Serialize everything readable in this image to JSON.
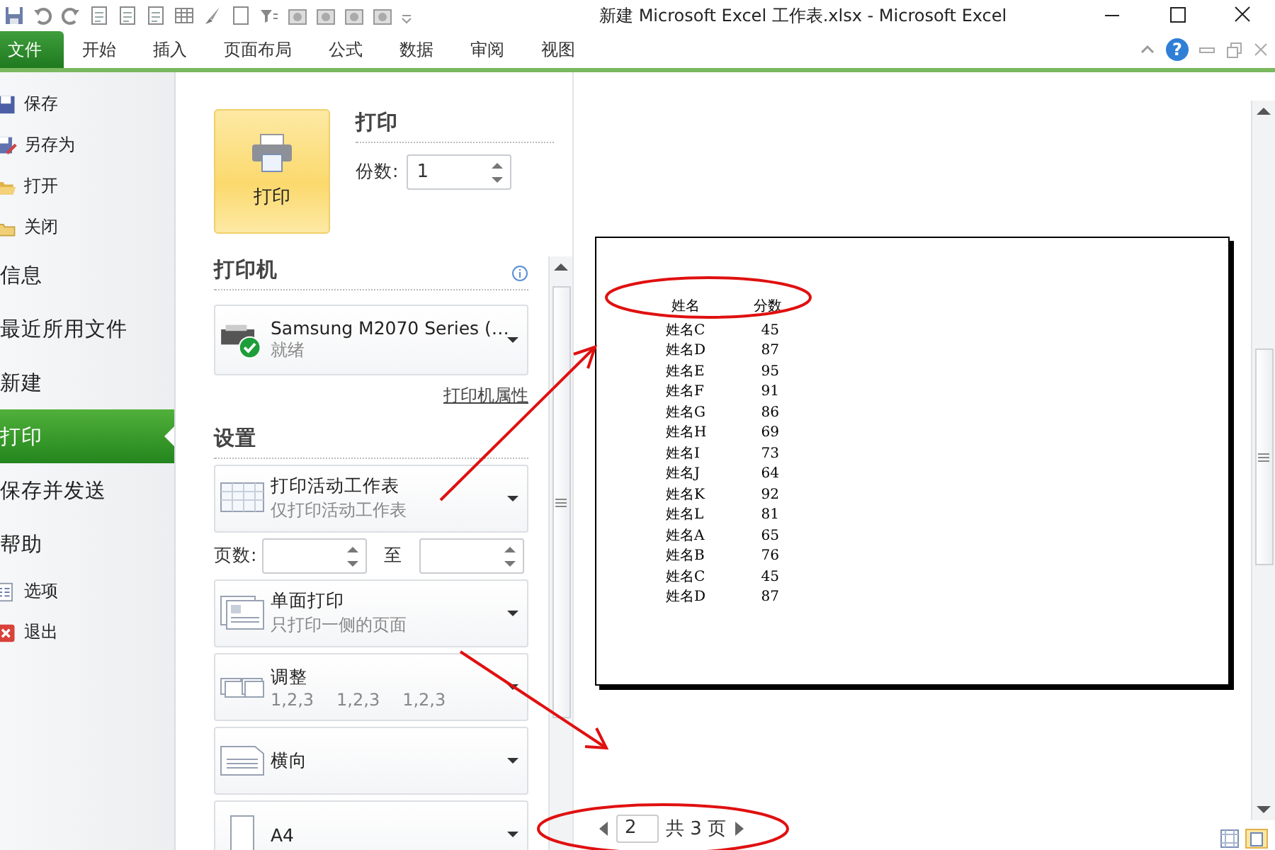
{
  "window": {
    "title": "新建 Microsoft Excel 工作表.xlsx  -  Microsoft Excel"
  },
  "ribbon_tabs": [
    {
      "label": "文件",
      "selected": true
    },
    {
      "label": "开始",
      "selected": false
    },
    {
      "label": "插入",
      "selected": false
    },
    {
      "label": "页面布局",
      "selected": false
    },
    {
      "label": "公式",
      "selected": false
    },
    {
      "label": "数据",
      "selected": false
    },
    {
      "label": "审阅",
      "selected": false
    },
    {
      "label": "视图",
      "selected": false
    }
  ],
  "help_glyph": "?",
  "backstage_nav": [
    {
      "label": "保存",
      "kind": "command",
      "selected": false
    },
    {
      "label": "另存为",
      "kind": "command",
      "selected": false
    },
    {
      "label": "打开",
      "kind": "command",
      "selected": false
    },
    {
      "label": "关闭",
      "kind": "command",
      "selected": false
    },
    {
      "label": "信息",
      "kind": "page",
      "selected": false
    },
    {
      "label": "最近所用文件",
      "kind": "page",
      "selected": false
    },
    {
      "label": "新建",
      "kind": "page",
      "selected": false
    },
    {
      "label": "打印",
      "kind": "page",
      "selected": true
    },
    {
      "label": "保存并发送",
      "kind": "page",
      "selected": false
    },
    {
      "label": "帮助",
      "kind": "page",
      "selected": false
    },
    {
      "label": "选项",
      "kind": "command",
      "selected": false
    },
    {
      "label": "退出",
      "kind": "command",
      "selected": false
    }
  ],
  "print": {
    "button_label": "打印",
    "header": "打印",
    "copies_label": "份数:",
    "copies": "1"
  },
  "printer": {
    "header": "打印机",
    "name": "Samsung M2070 Series (…",
    "status": "就绪",
    "properties_link": "打印机属性"
  },
  "settings": {
    "header": "设置",
    "items": [
      {
        "kind": "dropdown",
        "title": "打印活动工作表",
        "details": [
          "仅打印活动工作表"
        ]
      },
      {
        "kind": "page_range",
        "label": "页数:",
        "to_label": "至"
      },
      {
        "kind": "dropdown",
        "title": "单面打印",
        "details": [
          "只打印一侧的页面"
        ]
      },
      {
        "kind": "dropdown",
        "title": "调整",
        "details": [
          "1,2,3",
          "1,2,3",
          "1,2,3"
        ]
      },
      {
        "kind": "dropdown",
        "title": "横向"
      },
      {
        "kind": "dropdown",
        "title": "A4"
      }
    ]
  },
  "preview": {
    "table": {
      "columns": [
        "姓名",
        "分数"
      ],
      "rows": [
        [
          "姓名C",
          "45"
        ],
        [
          "姓名D",
          "87"
        ],
        [
          "姓名E",
          "95"
        ],
        [
          "姓名F",
          "91"
        ],
        [
          "姓名G",
          "86"
        ],
        [
          "姓名H",
          "69"
        ],
        [
          "姓名I",
          "73"
        ],
        [
          "姓名J",
          "64"
        ],
        [
          "姓名K",
          "92"
        ],
        [
          "姓名L",
          "81"
        ],
        [
          "姓名A",
          "65"
        ],
        [
          "姓名B",
          "76"
        ],
        [
          "姓名C",
          "45"
        ],
        [
          "姓名D",
          "87"
        ]
      ]
    },
    "page_nav": {
      "current": "2",
      "total_text": "共 3 页"
    }
  }
}
